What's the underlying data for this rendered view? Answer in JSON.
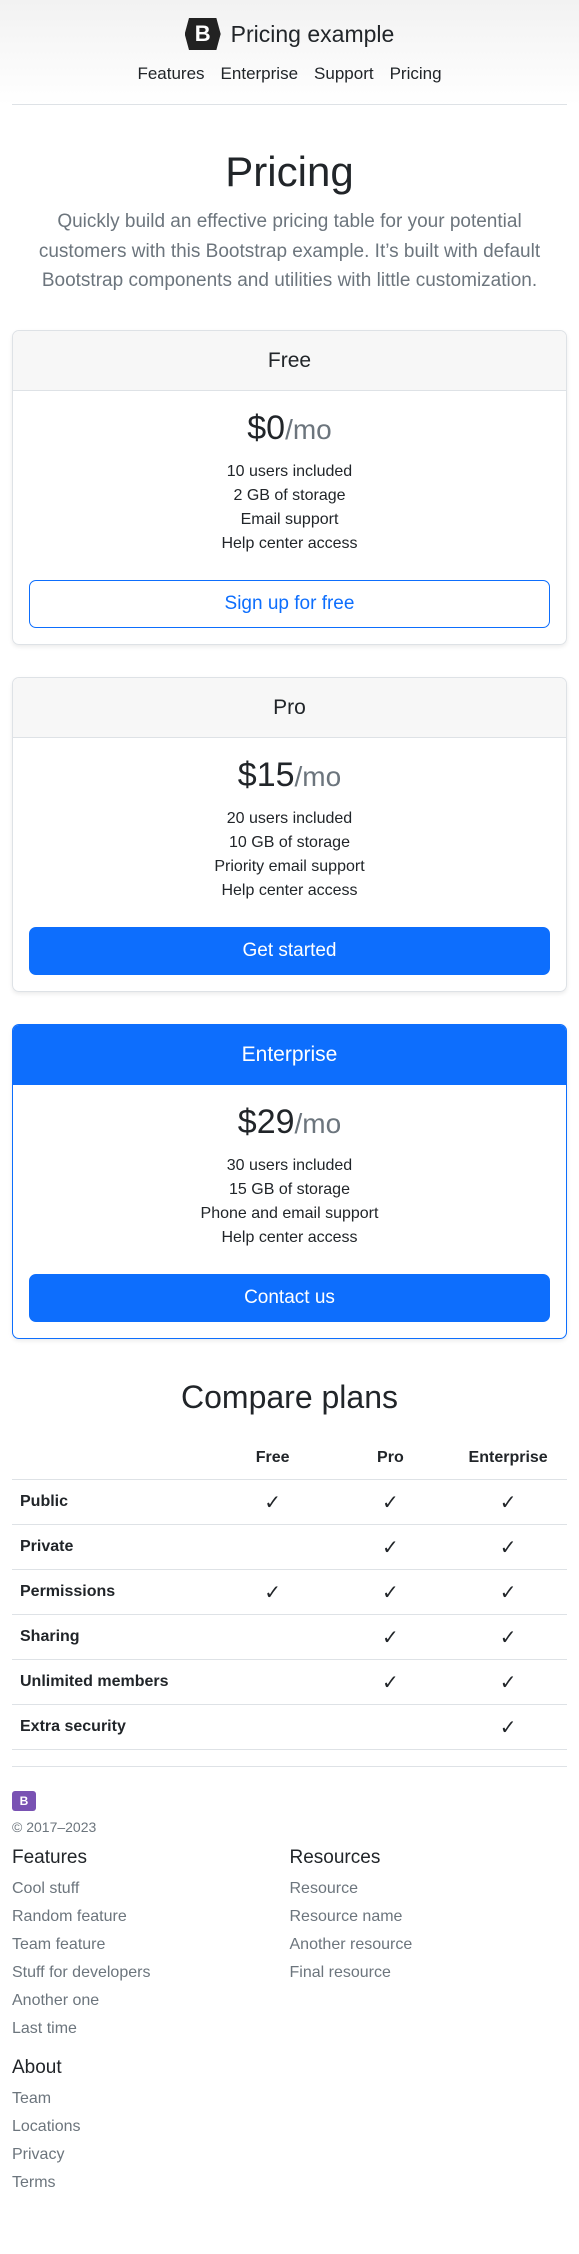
{
  "header": {
    "brand_letter": "B",
    "brand_text": "Pricing example",
    "nav": [
      "Features",
      "Enterprise",
      "Support",
      "Pricing"
    ]
  },
  "hero": {
    "title": "Pricing",
    "lead": "Quickly build an effective pricing table for your potential customers with this Bootstrap example. It’s built with default Bootstrap components and utilities with little customization."
  },
  "plans": [
    {
      "name": "Free",
      "price": "$0",
      "period": "/mo",
      "features": [
        "10 users included",
        "2 GB of storage",
        "Email support",
        "Help center access"
      ],
      "button": "Sign up for free"
    },
    {
      "name": "Pro",
      "price": "$15",
      "period": "/mo",
      "features": [
        "20 users included",
        "10 GB of storage",
        "Priority email support",
        "Help center access"
      ],
      "button": "Get started"
    },
    {
      "name": "Enterprise",
      "price": "$29",
      "period": "/mo",
      "features": [
        "30 users included",
        "15 GB of storage",
        "Phone and email support",
        "Help center access"
      ],
      "button": "Contact us"
    }
  ],
  "compare": {
    "title": "Compare plans",
    "columns": [
      "Free",
      "Pro",
      "Enterprise"
    ],
    "check_glyph": "✓",
    "rows": [
      {
        "label": "Public",
        "free": true,
        "pro": true,
        "enterprise": true
      },
      {
        "label": "Private",
        "free": false,
        "pro": true,
        "enterprise": true
      },
      {
        "label": "Permissions",
        "free": true,
        "pro": true,
        "enterprise": true
      },
      {
        "label": "Sharing",
        "free": false,
        "pro": true,
        "enterprise": true
      },
      {
        "label": "Unlimited members",
        "free": false,
        "pro": true,
        "enterprise": true
      },
      {
        "label": "Extra security",
        "free": false,
        "pro": false,
        "enterprise": true
      }
    ]
  },
  "footer": {
    "logo_letter": "B",
    "copyright": "© 2017–2023",
    "features_title": "Features",
    "features": [
      "Cool stuff",
      "Random feature",
      "Team feature",
      "Stuff for developers",
      "Another one",
      "Last time"
    ],
    "resources_title": "Resources",
    "resources": [
      "Resource",
      "Resource name",
      "Another resource",
      "Final resource"
    ],
    "about_title": "About",
    "about": [
      "Team",
      "Locations",
      "Privacy",
      "Terms"
    ]
  },
  "colors": {
    "primary": "#0d6efd",
    "muted": "#6c757d",
    "border": "#dee2e6",
    "brand_purple": "#7952b3"
  }
}
